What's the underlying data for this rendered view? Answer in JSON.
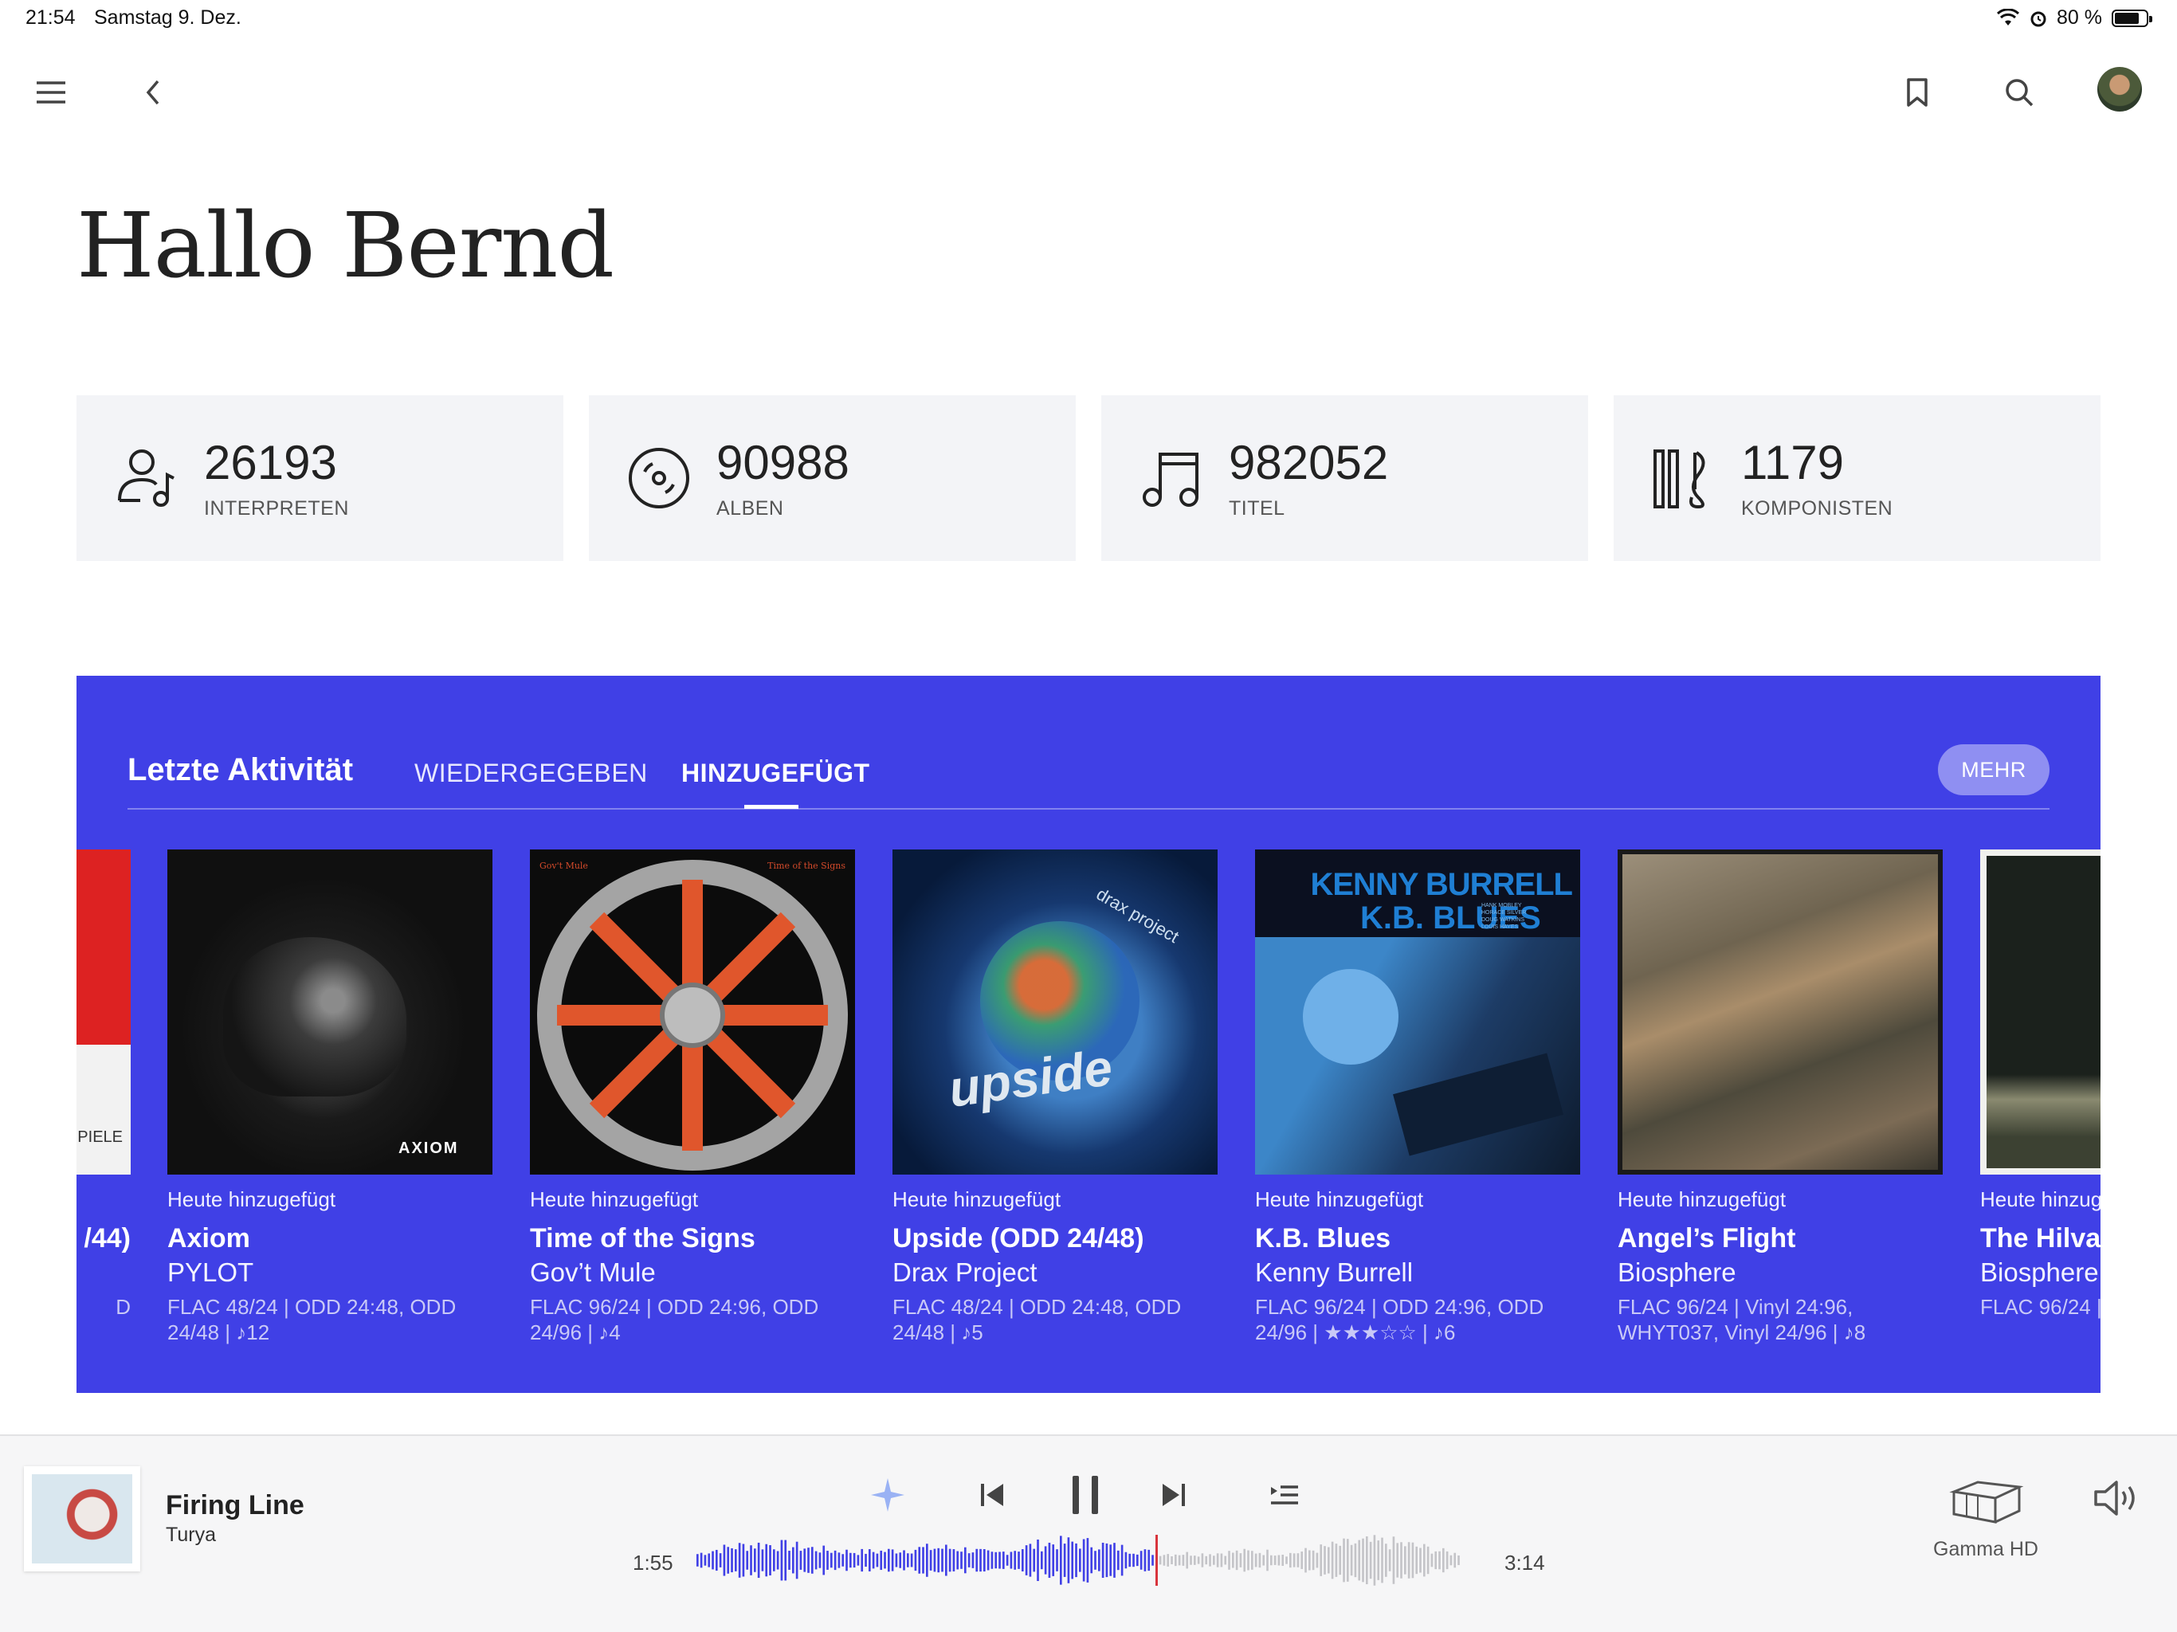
{
  "status_bar": {
    "time": "21:54",
    "date": "Samstag 9. Dez.",
    "battery": "80 %",
    "battery_level": 0.8
  },
  "nav": {
    "icons": [
      "menu-icon",
      "back-icon",
      "bookmark-icon",
      "search-icon",
      "avatar"
    ]
  },
  "greeting": "Hallo Bernd",
  "stats": [
    {
      "number": "26193",
      "label": "INTERPRETEN",
      "icon": "artist-icon"
    },
    {
      "number": "90988",
      "label": "ALBEN",
      "icon": "album-disc-icon"
    },
    {
      "number": "982052",
      "label": "TITEL",
      "icon": "music-note-icon"
    },
    {
      "number": "1179",
      "label": "KOMPONISTEN",
      "icon": "composer-icon"
    }
  ],
  "activity": {
    "title": "Letzte Aktivität",
    "tabs": [
      {
        "label": "WIEDERGEGEBEN",
        "active": false
      },
      {
        "label": "HINZUGEFÜGT",
        "active": true
      }
    ],
    "more_label": "MEHR",
    "partial_left": {
      "cover_text": "PIELE",
      "title_tail": "/44)",
      "meta_tail": "D"
    },
    "albums": [
      {
        "added": "Heute hinzugefügt",
        "title": "Axiom",
        "artist": "PYLOT",
        "meta": "FLAC 48/24 | ODD 24:48, ODD 24/48 | ♪12",
        "cover_text": "AXIOM"
      },
      {
        "added": "Heute hinzugefügt",
        "title": "Time of the Signs",
        "artist": "Gov’t Mule",
        "meta": "FLAC 96/24 | ODD 24:96, ODD 24/96 | ♪4",
        "cover_text_left": "Gov't Mule",
        "cover_text_right": "Time of the Signs"
      },
      {
        "added": "Heute hinzugefügt",
        "title": "Upside (ODD 24/48)",
        "artist": "Drax Project",
        "meta": "FLAC 48/24 | ODD 24:48, ODD 24/48 | ♪5",
        "cover_text": "upside",
        "cover_subtext": "drax project"
      },
      {
        "added": "Heute hinzugefügt",
        "title": "K.B. Blues",
        "artist": "Kenny Burrell",
        "meta": "FLAC 96/24 | ODD 24:96, ODD 24/96 | ★★★☆☆ | ♪6",
        "rating": 3,
        "cover_text": "KENNY BURRELL",
        "cover_subtext": "K.B. BLUES",
        "cover_credits": [
          "HANK MOBLEY",
          "HORACE SILVER",
          "DOUG WATKINS",
          "LOUIS HAYES"
        ]
      },
      {
        "added": "Heute hinzugefügt",
        "title": "Angel’s Flight",
        "artist": "Biosphere",
        "meta": "FLAC 96/24 | Vinyl 24:96, WHYT037, Vinyl 24/96 | ♪8"
      },
      {
        "added": "Heute hinzug",
        "title": "The Hilvare",
        "artist": "Biosphere",
        "meta": "FLAC 96/24 | BIO25LP, Vin"
      }
    ]
  },
  "player": {
    "title": "Firing Line",
    "artist": "Turya",
    "elapsed": "1:55",
    "duration": "3:14",
    "progress": 0.6,
    "device_label": "Gamma HD",
    "accent_color": "#4040e6"
  }
}
